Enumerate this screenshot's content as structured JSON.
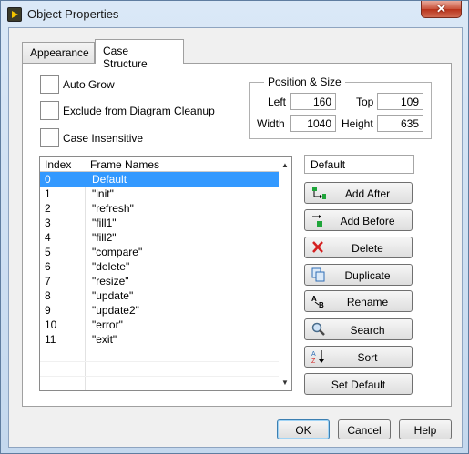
{
  "window": {
    "title": "Object Properties",
    "close_glyph": "✕"
  },
  "tabs": [
    {
      "label": "Appearance"
    },
    {
      "label": "Case Structure"
    }
  ],
  "checkboxes": [
    {
      "label": "Auto Grow",
      "checked": false
    },
    {
      "label": "Exclude from Diagram Cleanup",
      "checked": false
    },
    {
      "label": "Case Insensitive",
      "checked": false
    }
  ],
  "position_size": {
    "title": "Position & Size",
    "left_label": "Left",
    "left_value": "160",
    "top_label": "Top",
    "top_value": "109",
    "width_label": "Width",
    "width_value": "1040",
    "height_label": "Height",
    "height_value": "635"
  },
  "frame_list": {
    "columns": [
      "Index",
      "Frame Names"
    ],
    "rows": [
      {
        "index": "0",
        "name": "Default",
        "selected": true
      },
      {
        "index": "1",
        "name": "\"init\""
      },
      {
        "index": "2",
        "name": "\"refresh\""
      },
      {
        "index": "3",
        "name": "\"fill1\""
      },
      {
        "index": "4",
        "name": "\"fill2\""
      },
      {
        "index": "5",
        "name": "\"compare\""
      },
      {
        "index": "6",
        "name": "\"delete\""
      },
      {
        "index": "7",
        "name": "\"resize\""
      },
      {
        "index": "8",
        "name": "\"update\""
      },
      {
        "index": "9",
        "name": "\"update2\""
      },
      {
        "index": "10",
        "name": "\"error\""
      },
      {
        "index": "11",
        "name": "\"exit\""
      }
    ]
  },
  "frame_name_input": {
    "value": "Default"
  },
  "actions": [
    {
      "label": "Add After",
      "icon": "add-after-icon"
    },
    {
      "label": "Add Before",
      "icon": "add-before-icon"
    },
    {
      "label": "Delete",
      "icon": "delete-x-icon"
    },
    {
      "label": "Duplicate",
      "icon": "duplicate-icon"
    },
    {
      "label": "Rename",
      "icon": "rename-icon"
    },
    {
      "label": "Search",
      "icon": "magnifier-icon"
    },
    {
      "label": "Sort",
      "icon": "sort-az-icon"
    },
    {
      "label": "Set Default"
    }
  ],
  "footer": {
    "ok": "OK",
    "cancel": "Cancel",
    "help": "Help"
  },
  "colors": {
    "selection": "#3399ff",
    "delete_red": "#d42020",
    "add_green": "#1fa53a"
  }
}
